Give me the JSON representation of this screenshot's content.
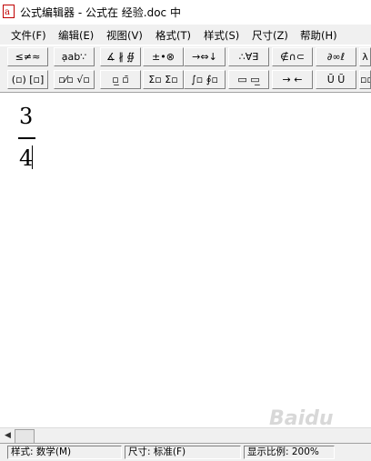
{
  "window": {
    "title": "公式编辑器 - 公式在 经验.doc 中"
  },
  "menu": [
    "文件(F)",
    "编辑(E)",
    "视图(V)",
    "格式(T)",
    "样式(S)",
    "尺寸(Z)",
    "帮助(H)"
  ],
  "toolbar_row1": [
    "≤≠≈",
    "ạab∵",
    "∡ ∦ ∯",
    "±•⊗",
    "→⇔↓",
    "∴∀∃",
    "∉∩⊂",
    "∂∞ℓ",
    "λ"
  ],
  "toolbar_row2": [
    "(▫) [▫]",
    "▫⁄▫ √▫",
    "▫̲ ▫̄",
    "Σ▫ Σ▫",
    "∫▫ ∮▫",
    "▭ ▭̲",
    "→ ←",
    "Ū Ũ",
    "▫▫▫"
  ],
  "equation": {
    "numerator": "3",
    "denominator": "4"
  },
  "status": {
    "style": "样式: 数学(M)",
    "size": "尺寸: 标准(F)",
    "zoom": "显示比例: 200%"
  },
  "watermark": "Baidu"
}
